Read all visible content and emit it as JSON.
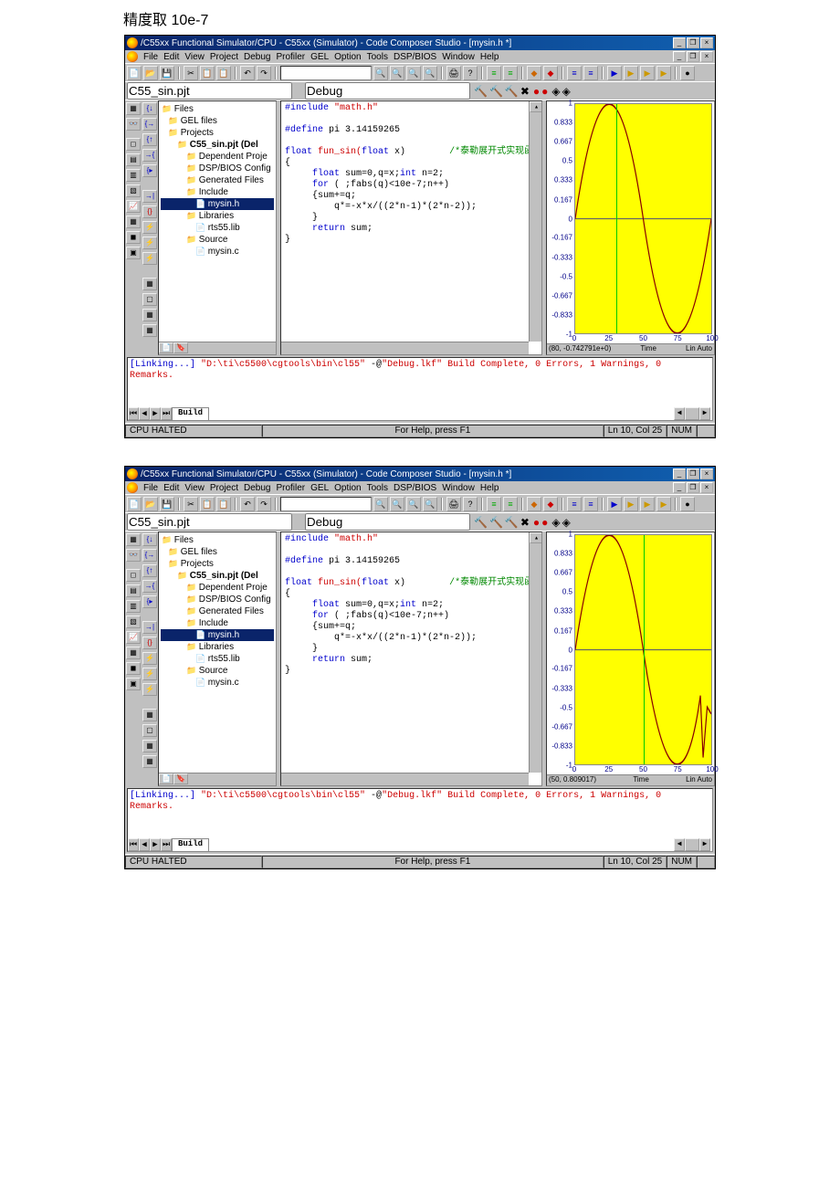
{
  "page_header": "精度取 10e-7",
  "window": {
    "title": "/C55xx Functional Simulator/CPU - C55xx (Simulator) - Code Composer Studio - [mysin.h *]",
    "menu": [
      "File",
      "Edit",
      "View",
      "Project",
      "Debug",
      "Profiler",
      "GEL",
      "Option",
      "Tools",
      "DSP/BIOS",
      "Window",
      "Help"
    ],
    "project_combo": "C55_sin.pjt",
    "config_combo": "Debug",
    "minimize": "_",
    "restore": "❐",
    "close": "×"
  },
  "tree": {
    "root": "Files",
    "items": [
      {
        "label": "GEL files",
        "indent": 1,
        "cls": "folder"
      },
      {
        "label": "Projects",
        "indent": 1,
        "cls": "folder"
      },
      {
        "label": "C55_sin.pjt (Del",
        "indent": 2,
        "cls": "folder bold"
      },
      {
        "label": "Dependent Proje",
        "indent": 3,
        "cls": "folder"
      },
      {
        "label": "DSP/BIOS Config",
        "indent": 3,
        "cls": "folder"
      },
      {
        "label": "Generated Files",
        "indent": 3,
        "cls": "folder"
      },
      {
        "label": "Include",
        "indent": 3,
        "cls": "folder"
      },
      {
        "label": "mysin.h",
        "indent": 4,
        "cls": "file selected"
      },
      {
        "label": "Libraries",
        "indent": 3,
        "cls": "folder"
      },
      {
        "label": "rts55.lib",
        "indent": 4,
        "cls": "file"
      },
      {
        "label": "Source",
        "indent": 3,
        "cls": "folder"
      },
      {
        "label": "mysin.c",
        "indent": 4,
        "cls": "file"
      }
    ]
  },
  "code": {
    "line1_a": "#include ",
    "line1_b": "\"math.h\"",
    "line3_a": "#define",
    "line3_b": " pi 3.14159265",
    "line5_a": "float",
    "line5_b": " fun_sin(",
    "line5_c": "float",
    "line5_d": " x)        ",
    "line5_e": "/*泰勒展开式实现函数*/",
    "line6": "{",
    "line7_a": "     float",
    "line7_b": " sum=0,q=x;",
    "line7_c": "int",
    "line7_d": " n=2;",
    "line8_a": "     for",
    "line8_b": " ( ;fabs(q)<10e-7;n++)",
    "line9": "     {sum+=q;",
    "line10": "         q*=-x*x/((2*n-1)*(2*n-2));",
    "line11": "     }",
    "line12_a": "     return",
    "line12_b": " sum;",
    "line13": "}"
  },
  "output": {
    "link_a": "[Linking...] ",
    "link_b": "\"D:\\ti\\c5500\\cgtools\\bin\\cl55\"",
    "link_c": " -@",
    "link_d": "\"Debug.lkf\"",
    "complete": "Build Complete,",
    "errors": "  0 Errors, 1 Warnings, 0 Remarks.",
    "tab": "Build"
  },
  "statusbar": {
    "cpu": "CPU HALTED",
    "help": "For Help, press F1",
    "pos": "Ln 10, Col 25",
    "mode": "NUM"
  },
  "chart_data": [
    {
      "type": "line",
      "x": [
        0,
        10,
        20,
        25,
        30,
        40,
        50,
        60,
        70,
        75,
        80,
        90,
        100
      ],
      "values": [
        0,
        0.588,
        0.951,
        1.0,
        0.951,
        0.588,
        0,
        -0.588,
        -0.951,
        -1.0,
        -0.951,
        -0.588,
        0
      ],
      "ylim": [
        -1.0,
        1.0
      ],
      "xlim": [
        0,
        100
      ],
      "y_ticks": [
        1.0,
        0.833,
        0.667,
        0.5,
        0.333,
        0.167,
        0,
        -0.167,
        -0.333,
        -0.5,
        -0.667,
        -0.833,
        -1.0
      ],
      "x_ticks": [
        0,
        25.0,
        50.0,
        75.0,
        100
      ],
      "status_left": "(80, -0.742791e+0)",
      "status_mid": "Time",
      "status_right1": "Lin",
      "status_right2": "Auto"
    },
    {
      "type": "line",
      "x": [
        0,
        10,
        20,
        25,
        30,
        40,
        50,
        60,
        70,
        75,
        80,
        90,
        95,
        100
      ],
      "values": [
        0,
        0.588,
        0.951,
        1.0,
        0.951,
        0.588,
        0,
        -0.588,
        -0.951,
        -1.0,
        -0.951,
        -0.45,
        -0.95,
        -0.55
      ],
      "ylim": [
        -1.0,
        1.0
      ],
      "xlim": [
        0,
        100
      ],
      "y_ticks": [
        1.0,
        0.833,
        0.667,
        0.5,
        0.333,
        0.167,
        0,
        -0.167,
        -0.333,
        -0.5,
        -0.667,
        -0.833,
        -1.0
      ],
      "x_ticks": [
        0,
        25.0,
        50.0,
        75.0,
        100
      ],
      "status_left": "(50, 0.809017)",
      "status_mid": "Time",
      "status_right1": "Lin",
      "status_right2": "Auto"
    }
  ]
}
